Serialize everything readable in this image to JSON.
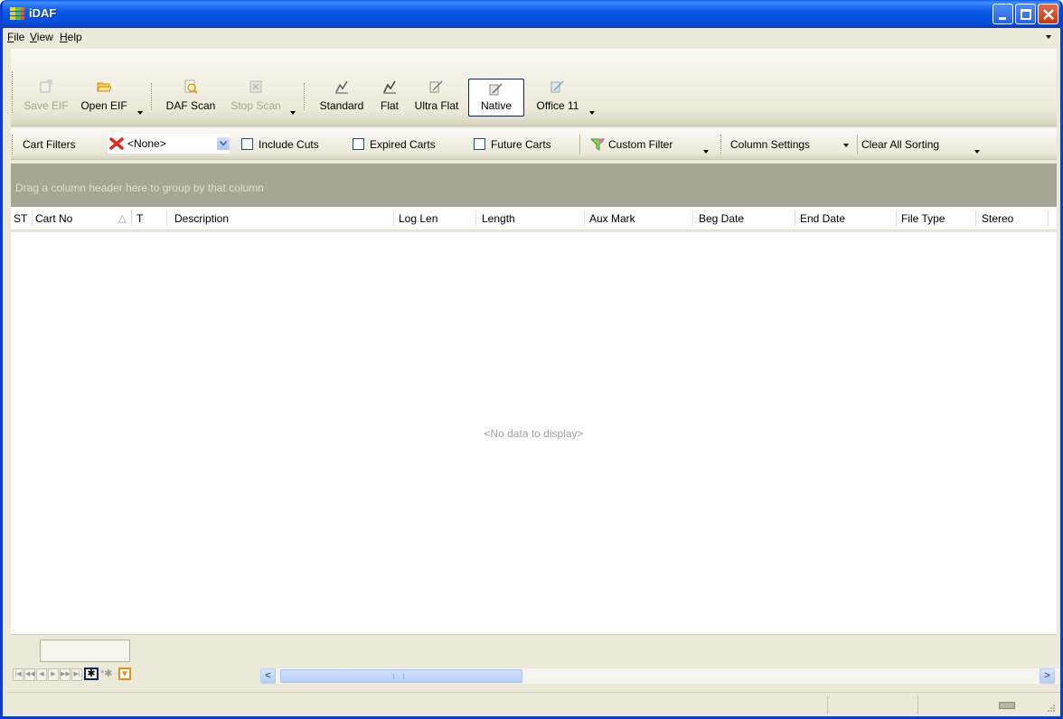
{
  "window": {
    "title": "iDAF"
  },
  "menu": {
    "items": [
      {
        "first": "F",
        "rest": "ile"
      },
      {
        "first": "V",
        "rest": "iew"
      },
      {
        "first": "H",
        "rest": "elp"
      }
    ]
  },
  "toolbar": {
    "save_eif": "Save EIF",
    "open_eif": "Open EIF",
    "daf_scan": "DAF Scan",
    "stop_scan": "Stop Scan",
    "standard": "Standard",
    "flat": "Flat",
    "ultra_flat": "Ultra Flat",
    "native": "Native",
    "office11": "Office 11"
  },
  "filters": {
    "cart_filters_label": "Cart Filters",
    "cart_filter_value": "<None>",
    "include_cuts": "Include Cuts",
    "expired_carts": "Expired Carts",
    "future_carts": "Future Carts",
    "custom_filter": "Custom Filter",
    "column_settings": "Column Settings",
    "clear_all_sorting": "Clear All Sorting"
  },
  "grid": {
    "group_hint": "Drag a column header here to group by that column",
    "columns": [
      "ST",
      "Cart No",
      "T",
      "Description",
      "Log Len",
      "Length",
      "Aux Mark",
      "Beg Date",
      "End Date",
      "File Type",
      "Stereo"
    ],
    "sort_indicator": "△",
    "empty_text": "<No data to display>"
  },
  "colors": {
    "title_bar": "#0a5ae6",
    "group_panel": "#a8a595",
    "chrome": "#ece9d8"
  }
}
